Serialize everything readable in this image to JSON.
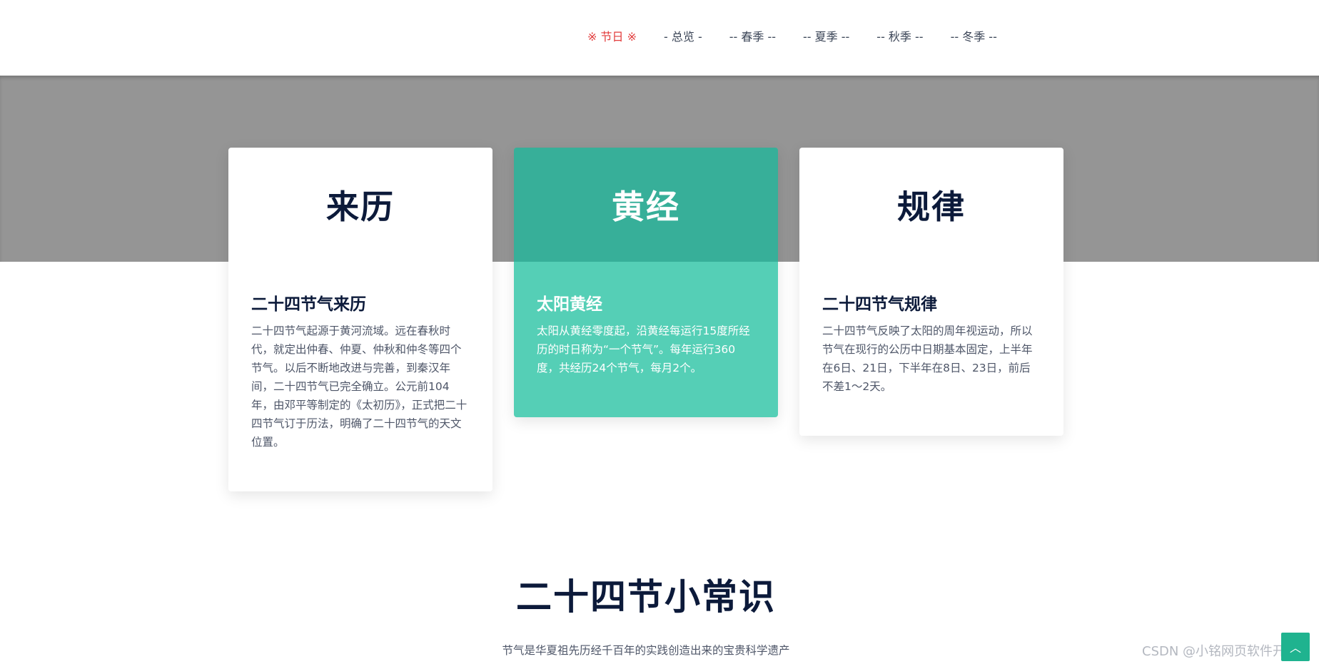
{
  "nav": {
    "items": [
      {
        "label": "※ 节日 ※",
        "active": true
      },
      {
        "label": "- 总览 -",
        "active": false
      },
      {
        "label": "-- 春季 --",
        "active": false
      },
      {
        "label": "-- 夏季 --",
        "active": false
      },
      {
        "label": "-- 秋季 --",
        "active": false
      },
      {
        "label": "-- 冬季 --",
        "active": false
      }
    ]
  },
  "cards": [
    {
      "title": "来历",
      "subtitle": "二十四节气来历",
      "text": "二十四节气起源于黄河流域。远在春秋时代，就定出仲春、仲夏、仲秋和仲冬等四个节气。以后不断地改进与完善，到秦汉年间，二十四节气已完全确立。公元前104年，由邓平等制定的《太初历》，正式把二十四节气订于历法，明确了二十四节气的天文位置。"
    },
    {
      "title": "黄经",
      "subtitle": "太阳黄经",
      "text": "太阳从黄经零度起，沿黄经每运行15度所经历的时日称为“一个节气”。每年运行360度，共经历24个节气，每月2个。"
    },
    {
      "title": "规律",
      "subtitle": "二十四节气规律",
      "text": "二十四节气反映了太阳的周年视运动，所以节气在现行的公历中日期基本固定，上半年在6日、21日，下半年在8日、23日，前后不差1～2天。"
    }
  ],
  "section": {
    "title": "二十四节小常识",
    "text": "节气是华夏祖先历经千百年的实践创造出来的宝贵科学遗产"
  },
  "watermark": "CSDN @小铭网页软件开发",
  "colors": {
    "active_nav": "#e23b3b",
    "band": "#959595",
    "accent_head": "#37af99",
    "accent_body": "#55cfb6"
  }
}
